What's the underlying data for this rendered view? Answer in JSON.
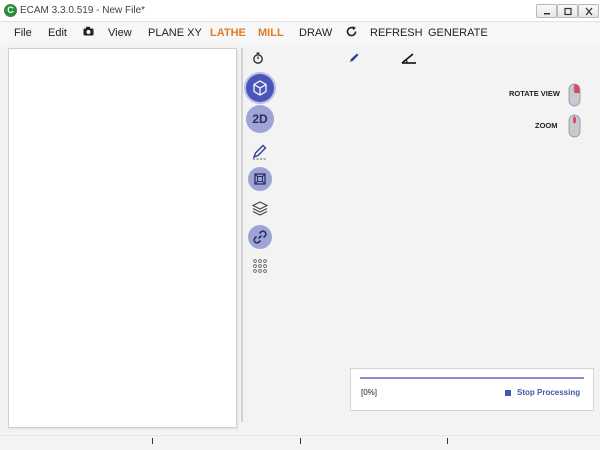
{
  "window": {
    "app_icon_letter": "C",
    "title": "ECAM 3.3.0.519 - New File*",
    "buttons": [
      "minimize-icon",
      "maximize-icon",
      "close-icon"
    ]
  },
  "menu": {
    "file": "File",
    "edit": "Edit",
    "camera_icon": "camera-icon",
    "view": "View",
    "plane": "PLANE XY",
    "lathe": "LATHE",
    "mill": "MILL",
    "draw": "DRAW",
    "refresh_icon": "refresh-icon",
    "refresh": "REFRESH",
    "generate": "GENERATE",
    "accent_color": "#e07b27"
  },
  "toolbar_top": [
    "timer-icon",
    "pencil-icon",
    "angle-icon"
  ],
  "tools": {
    "view_3d_icon": "cube-3d-icon",
    "view_2d": "2D",
    "sketch_icon": "sketch-pen-icon",
    "frame_icon": "frame-box-icon",
    "layers_icon": "layers-icon",
    "link_icon": "link-icon",
    "grid_icon": "dot-grid-icon"
  },
  "side_hints": {
    "rotate": "ROTATE VIEW",
    "zoom": "ZOOM"
  },
  "progress": {
    "label": "[0%]",
    "value": 1.0,
    "stop": "Stop Processing",
    "accent_color": "#3f5aa8"
  }
}
